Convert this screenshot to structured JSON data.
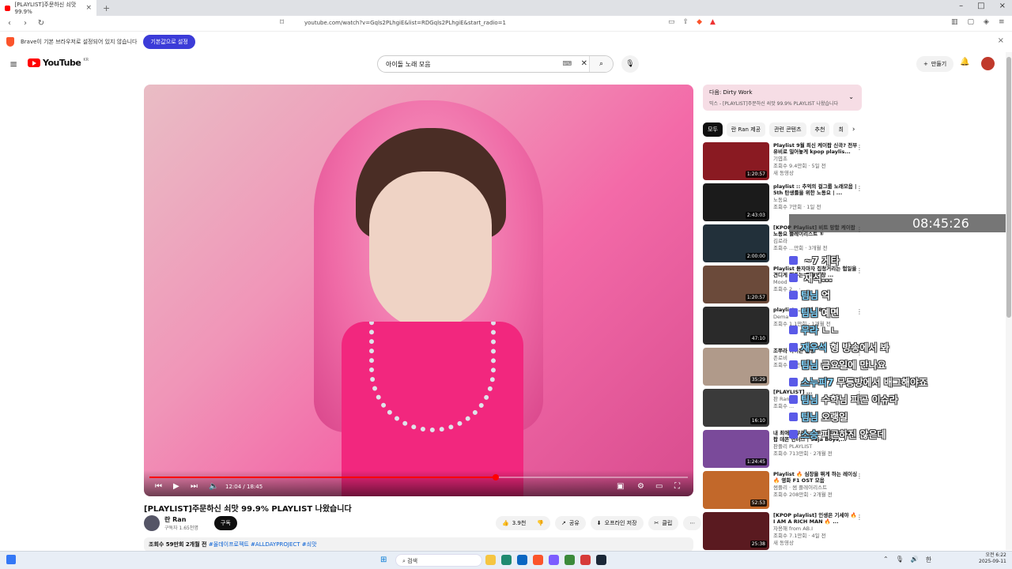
{
  "browser": {
    "tab_title": "[PLAYLIST]주문하신 쇠맛 99.9%",
    "url": "youtube.com/watch?v=Gqls2PLhgiE&list=RDGqls2PLhgiE&start_radio=1",
    "infobar_text": "Brave이 기본 브라우저로 설정되어 있지 않습니다",
    "infobar_button": "기본값으로 설정"
  },
  "youtube": {
    "logo_text": "YouTube",
    "logo_region": "KR",
    "search_value": "아이돌 노래 모음",
    "create_label": "만들기"
  },
  "player": {
    "current_time": "12:04",
    "duration": "18:45",
    "progress": 0.643
  },
  "video": {
    "title": "[PLAYLIST]주문하신 쇠맛 99.9% PLAYLIST 나왔습니다",
    "channel": "란 Ran",
    "subscribers": "구독자 1.65천명",
    "subscribe_label": "구독",
    "likes": "3.9천",
    "share": "공유",
    "offline": "오프라인 저장",
    "clip": "클립",
    "desc_stats": "조회수 59만회  2개월 전",
    "desc_tags": "#올데이프로젝트 #ALLDAYPROJECT #쇠맛"
  },
  "up_next": {
    "line1": "다음: Dirty Work",
    "line2": "믹스 - [PLAYLIST]주문하신 쇠맛 99.9% PLAYLIST 나왔습니다"
  },
  "chips": [
    "모두",
    "란 Ran 제공",
    "관련 콘텐츠",
    "추천",
    "최"
  ],
  "recommendations": [
    {
      "title": "Playlist 9월 최신 케이팝 신곡? 전부 유비로 밀어놓게 kpop playlis...",
      "channel": "기엽초",
      "meta": "조회수 9.4만회 · 5일 전",
      "extra": "새 동영상",
      "duration": "1:20:57",
      "color": "#8a1a22"
    },
    {
      "title": "playlist :: 추억의 걸그룹 노래모음 | 5th 탄생를을 위한 노동요 | ...",
      "channel": "노동요",
      "meta": "조회수 7만회 · 1일 전",
      "extra": "",
      "duration": "2:43:03",
      "color": "#1b1b1b"
    },
    {
      "title": "[KPOP Playlist] 비트 망함 케이팝 노동요 플레이리스트 ⑤",
      "channel": "김로라",
      "meta": "조회수 ...만회 · 3개월 전",
      "extra": "",
      "duration": "2:00:00",
      "color": "#22303a"
    },
    {
      "title": "Playlist 듣자마자 집청거리는 험일을 견디게 해주는 요즘 가창 ...",
      "channel": "Mood",
      "meta": "조회수 2... · ...",
      "extra": "",
      "duration": "1:20:57",
      "color": "#6b4a3a"
    },
    {
      "title": "playlist ... 노래 | Boo...",
      "channel": "Dema",
      "meta": "조회수 1.1만회 · 1개월 전",
      "extra": "",
      "duration": "47:10",
      "color": "#2a2a2a"
    },
    {
      "title": "조쭈라 아이돈 팔망",
      "channel": "존로비",
      "meta": "조회수 35만회 · 1년 전",
      "extra": "",
      "duration": "35:29",
      "color": "#b09a8a"
    },
    {
      "title": "[PLAYLIST] ...",
      "channel": "판 Ran",
      "meta": "조회수 ...",
      "extra": "",
      "duration": "16:10",
      "color": "#3a3a3a"
    },
    {
      "title": "내 최애가 부르는 다른 나루...? | 케이팝 데몬 헌터스 | Saja Boys,...",
      "channel": "판플리 PLAYLIST",
      "meta": "조회수 713만회 · 2개월 전",
      "extra": "",
      "duration": "1:24:45",
      "color": "#7a4a9a"
    },
    {
      "title": "Playlist 🔥 심장을 뛰게 하는 레이싱 🔥 영화 F1 OST 모음",
      "channel": "썸플리 · 썸 플레이리스트",
      "meta": "조회수 208만회 · 2개월 전",
      "extra": "",
      "duration": "52:53",
      "color": "#c2682a"
    },
    {
      "title": "[KPOP playlist] 인생은 기세야 🔥 I AM A RICH MAN 🔥 ...",
      "channel": "자용해 from AB.I",
      "meta": "조회수 7.1만회 · 4일 전",
      "extra": "새 동영상",
      "duration": "25:38",
      "color": "#5a1a20"
    }
  ],
  "overlay": {
    "clock": "08:45:26",
    "chat": [
      {
        "nick": "",
        "msg": "~7 게타"
      },
      {
        "nick": "",
        "msg": "재석..."
      },
      {
        "nick": "팀님",
        "msg": "억"
      },
      {
        "nick": "팀님",
        "msg": "예면"
      },
      {
        "nick": "무라",
        "msg": "ㄴㄴ"
      },
      {
        "nick": "재우석",
        "msg": "형 방송에서 봐"
      },
      {
        "nick": "팀님",
        "msg": "금요일에 만나요"
      },
      {
        "nick": "스누피7",
        "msg": "무등방에서 배그해야죠"
      },
      {
        "nick": "팀님",
        "msg": "수학님 피곤 이슈라"
      },
      {
        "nick": "팀님",
        "msg": "오랭일"
      },
      {
        "nick": "스승",
        "msg": "피곤하진 않은데"
      }
    ]
  },
  "taskbar": {
    "search_placeholder": "검색",
    "time": "오전 6:22",
    "date": "2025-09-11",
    "ime": "한"
  }
}
